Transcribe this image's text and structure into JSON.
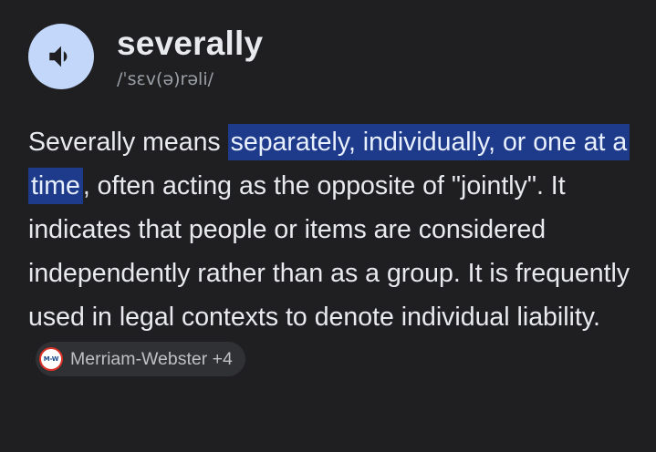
{
  "entry": {
    "word": "severally",
    "phonetic": "/ˈsɛv(ə)rəli/",
    "audio_icon": "speaker-icon"
  },
  "definition": {
    "intro": "Severally means ",
    "highlight": "separately, individually, or one at a time",
    "body": ", often acting as the opposite of \"jointly\". It indicates that people or items are considered independently rather than as a group. It is frequently used in legal contexts to denote individual liability."
  },
  "source": {
    "logo_text": "M-W",
    "label": "Merriam-Webster +4"
  },
  "colors": {
    "background": "#1f1f22",
    "highlight": "#1e3a8a",
    "audio_button": "#c2d7fa",
    "chip": "#303134"
  }
}
